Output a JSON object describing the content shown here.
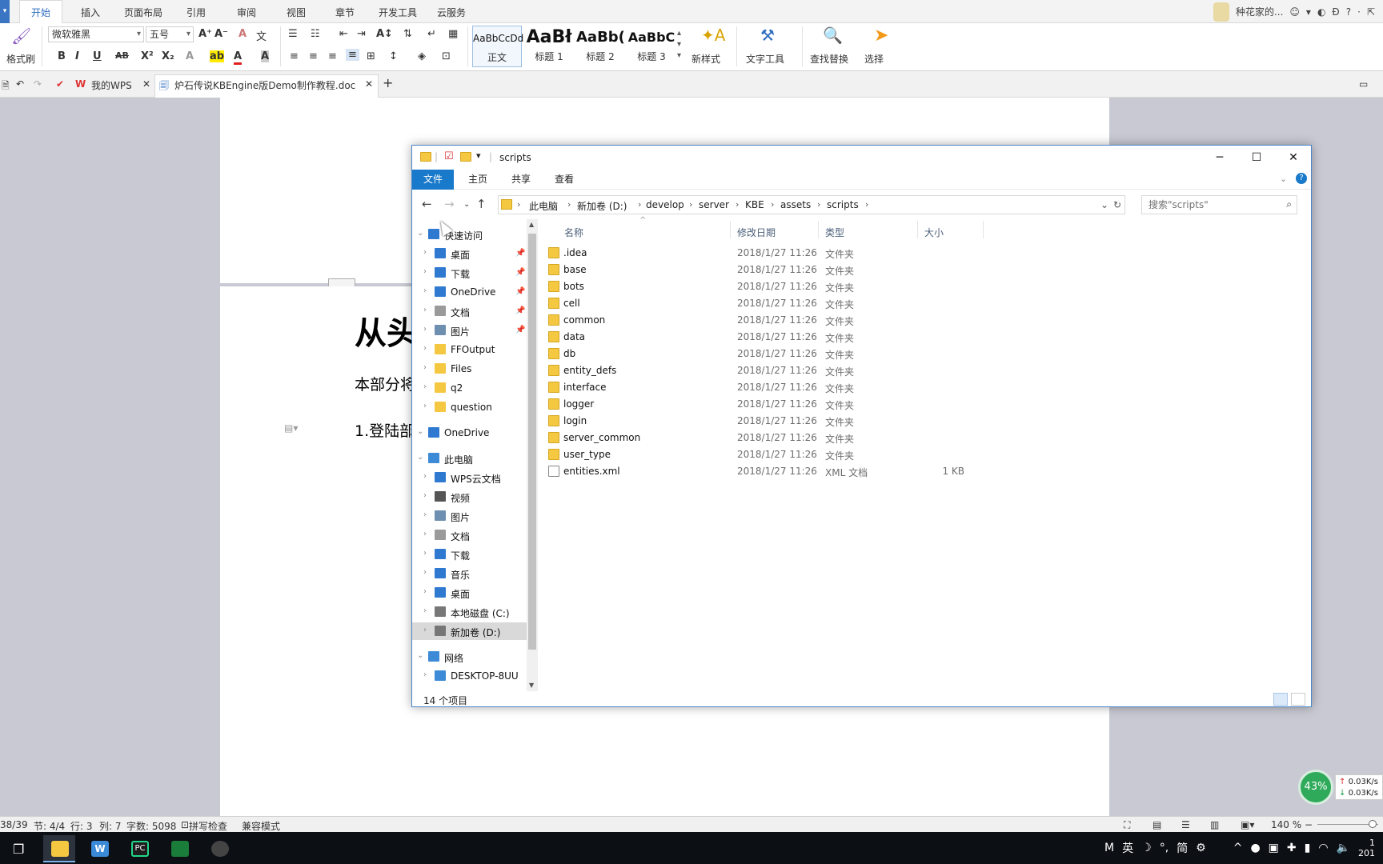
{
  "wps": {
    "app_button": "▾",
    "tabs": [
      "开始",
      "插入",
      "页面布局",
      "引用",
      "审阅",
      "视图",
      "章节",
      "开发工具",
      "云服务"
    ],
    "user_name": "种花家的...",
    "ribbon": {
      "format_painter": "格式刷",
      "font_name": "微软雅黑",
      "font_size": "五号",
      "style_samples": [
        {
          "sample": "AaBbCcDd",
          "name": "正文"
        },
        {
          "sample": "AaBł",
          "name": "标题 1"
        },
        {
          "sample": "AaBb(",
          "name": "标题 2"
        },
        {
          "sample": "AaBbC",
          "name": "标题 3"
        }
      ],
      "new_style": "新样式",
      "text_tools": "文字工具",
      "find_replace": "查找替换",
      "select": "选择"
    },
    "doc_tabs": {
      "my_wps": "我的WPS",
      "active_doc": "炉石传说KBEngine版Demo制作教程.doc",
      "add": "+"
    },
    "document": {
      "heading": "从头",
      "para1": "本部分将",
      "para2": "1.登陆部"
    },
    "statusbar": {
      "page": "38/39",
      "section": "节: 4/4",
      "row": "行: 3",
      "col": "列: 7",
      "words": "字数: 5098",
      "spell": "拼写检查",
      "compat": "兼容模式",
      "zoom": "140 %"
    },
    "net_widget": {
      "percent": "43%",
      "up": "0.03K/s",
      "down": "0.03K/s"
    }
  },
  "taskbar": {
    "tray": {
      "ime_mode": "英",
      "ime_simplified": "简",
      "clock_line1": "1",
      "clock_line2": "201"
    }
  },
  "explorer": {
    "title": "scripts",
    "menu": [
      "文件",
      "主页",
      "共享",
      "查看"
    ],
    "breadcrumb": [
      "此电脑",
      "新加卷 (D:)",
      "develop",
      "server",
      "KBE",
      "assets",
      "scripts"
    ],
    "search_placeholder": "搜索\"scripts\"",
    "nav": [
      {
        "label": "快速访问",
        "icon": "star-icon",
        "level": 0,
        "pinned": false
      },
      {
        "label": "桌面",
        "icon": "desktop-icon",
        "level": 1,
        "pinned": true
      },
      {
        "label": "下载",
        "icon": "download-icon",
        "level": 1,
        "pinned": true
      },
      {
        "label": "OneDrive",
        "icon": "cloud-icon",
        "level": 1,
        "pinned": true
      },
      {
        "label": "文档",
        "icon": "document-icon",
        "level": 1,
        "pinned": true
      },
      {
        "label": "图片",
        "icon": "picture-icon",
        "level": 1,
        "pinned": true
      },
      {
        "label": "FFOutput",
        "icon": "folder-icon",
        "level": 1,
        "pinned": false
      },
      {
        "label": "Files",
        "icon": "folder-icon",
        "level": 1,
        "pinned": false
      },
      {
        "label": "q2",
        "icon": "folder-icon",
        "level": 1,
        "pinned": false
      },
      {
        "label": "question",
        "icon": "folder-icon",
        "level": 1,
        "pinned": false
      },
      {
        "label": "OneDrive",
        "icon": "cloud-icon",
        "level": 0,
        "pinned": false
      },
      {
        "label": "此电脑",
        "icon": "computer-icon",
        "level": 0,
        "pinned": false
      },
      {
        "label": "WPS云文档",
        "icon": "cloud-icon",
        "level": 1,
        "pinned": false
      },
      {
        "label": "视频",
        "icon": "video-icon",
        "level": 1,
        "pinned": false
      },
      {
        "label": "图片",
        "icon": "picture-icon",
        "level": 1,
        "pinned": false
      },
      {
        "label": "文档",
        "icon": "document-icon",
        "level": 1,
        "pinned": false
      },
      {
        "label": "下载",
        "icon": "download-icon",
        "level": 1,
        "pinned": false
      },
      {
        "label": "音乐",
        "icon": "music-icon",
        "level": 1,
        "pinned": false
      },
      {
        "label": "桌面",
        "icon": "desktop-icon",
        "level": 1,
        "pinned": false
      },
      {
        "label": "本地磁盘 (C:)",
        "icon": "drive-icon",
        "level": 1,
        "pinned": false
      },
      {
        "label": "新加卷 (D:)",
        "icon": "drive-icon",
        "level": 1,
        "pinned": false,
        "selected": true
      },
      {
        "label": "网络",
        "icon": "network-icon",
        "level": 0,
        "pinned": false
      },
      {
        "label": "DESKTOP-8UU",
        "icon": "computer-icon",
        "level": 1,
        "pinned": false
      }
    ],
    "columns": [
      "名称",
      "修改日期",
      "类型",
      "大小"
    ],
    "files": [
      {
        "name": ".idea",
        "date": "2018/1/27 11:26",
        "type": "文件夹",
        "size": ""
      },
      {
        "name": "base",
        "date": "2018/1/27 11:26",
        "type": "文件夹",
        "size": ""
      },
      {
        "name": "bots",
        "date": "2018/1/27 11:26",
        "type": "文件夹",
        "size": ""
      },
      {
        "name": "cell",
        "date": "2018/1/27 11:26",
        "type": "文件夹",
        "size": ""
      },
      {
        "name": "common",
        "date": "2018/1/27 11:26",
        "type": "文件夹",
        "size": ""
      },
      {
        "name": "data",
        "date": "2018/1/27 11:26",
        "type": "文件夹",
        "size": ""
      },
      {
        "name": "db",
        "date": "2018/1/27 11:26",
        "type": "文件夹",
        "size": ""
      },
      {
        "name": "entity_defs",
        "date": "2018/1/27 11:26",
        "type": "文件夹",
        "size": ""
      },
      {
        "name": "interface",
        "date": "2018/1/27 11:26",
        "type": "文件夹",
        "size": ""
      },
      {
        "name": "logger",
        "date": "2018/1/27 11:26",
        "type": "文件夹",
        "size": ""
      },
      {
        "name": "login",
        "date": "2018/1/27 11:26",
        "type": "文件夹",
        "size": ""
      },
      {
        "name": "server_common",
        "date": "2018/1/27 11:26",
        "type": "文件夹",
        "size": ""
      },
      {
        "name": "user_type",
        "date": "2018/1/27 11:26",
        "type": "文件夹",
        "size": ""
      },
      {
        "name": "entities.xml",
        "date": "2018/1/27 11:26",
        "type": "XML 文档",
        "size": "1 KB"
      }
    ],
    "item_count": "14 个项目"
  },
  "colors": {
    "accent": "#1979ca",
    "folder": "#f5c842",
    "wps_blue": "#2d6dbf",
    "net_green": "#2eaa5a"
  }
}
